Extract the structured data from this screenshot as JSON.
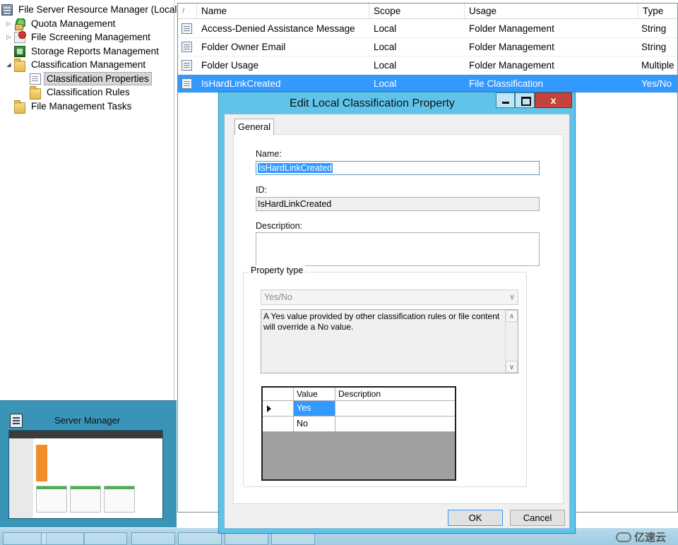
{
  "tree": {
    "items": [
      {
        "label": "File Server Resource Manager (Local)",
        "icon": "server-icon",
        "expander": ""
      },
      {
        "label": "Quota Management",
        "icon": "quota-icon",
        "expander": "▷"
      },
      {
        "label": "File Screening Management",
        "icon": "file-screen-icon",
        "expander": "▷"
      },
      {
        "label": "Storage Reports Management",
        "icon": "storage-reports-icon",
        "expander": ""
      },
      {
        "label": "Classification Management",
        "icon": "folder-icon",
        "expander": "◢"
      },
      {
        "label": "Classification Properties",
        "icon": "page-icon",
        "expander": ""
      },
      {
        "label": "Classification Rules",
        "icon": "folder-icon",
        "expander": ""
      },
      {
        "label": "File Management Tasks",
        "icon": "folder-icon",
        "expander": ""
      }
    ]
  },
  "thumbnail": {
    "title": "Server Manager"
  },
  "list": {
    "sort_indicator": "/",
    "columns": [
      "Name",
      "Scope",
      "Usage",
      "Type"
    ],
    "rows": [
      {
        "name": "Access-Denied Assistance Message",
        "scope": "Local",
        "usage": "Folder Management",
        "type": "String"
      },
      {
        "name": "Folder Owner Email",
        "scope": "Local",
        "usage": "Folder Management",
        "type": "String"
      },
      {
        "name": "Folder Usage",
        "scope": "Local",
        "usage": "Folder Management",
        "type": "Multiple"
      },
      {
        "name": "IsHardLinkCreated",
        "scope": "Local",
        "usage": "File Classification",
        "type": "Yes/No"
      }
    ]
  },
  "dialog": {
    "title": "Edit Local Classification Property",
    "close_glyph": "x",
    "tab": "General",
    "name_label": "Name:",
    "name_value": "IsHardLinkCreated",
    "id_label": "ID:",
    "id_value": "IsHardLinkCreated",
    "description_label": "Description:",
    "description_value": "",
    "property_type_label": "Property type",
    "property_type_value": "Yes/No",
    "property_type_description": "A Yes value provided by other classification rules or file content will override a No value.",
    "grid": {
      "columns": [
        "Value",
        "Description"
      ],
      "rows": [
        {
          "value": "Yes",
          "description": ""
        },
        {
          "value": "No",
          "description": ""
        }
      ]
    },
    "ok_label": "OK",
    "cancel_label": "Cancel"
  },
  "watermark": {
    "text": "亿速云"
  },
  "colors": {
    "selection": "#3399ff",
    "dialog_frame": "#5fc3ea",
    "close_button": "#c7423a",
    "thumbnail_bg": "#3a94b8"
  }
}
